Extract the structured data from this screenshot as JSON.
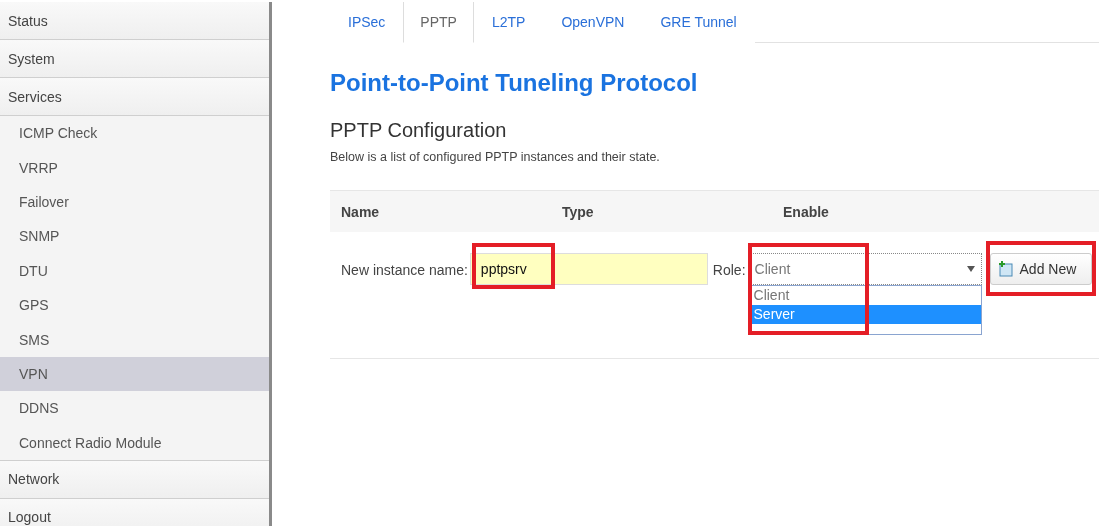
{
  "sidebar": {
    "items": [
      {
        "label": "Status",
        "selected": false
      },
      {
        "label": "System",
        "selected": false
      },
      {
        "label": "Services",
        "selected": false,
        "children": [
          {
            "label": "ICMP Check",
            "selected": false
          },
          {
            "label": "VRRP",
            "selected": false
          },
          {
            "label": "Failover",
            "selected": false
          },
          {
            "label": "SNMP",
            "selected": false
          },
          {
            "label": "DTU",
            "selected": false
          },
          {
            "label": "GPS",
            "selected": false
          },
          {
            "label": "SMS",
            "selected": false
          },
          {
            "label": "VPN",
            "selected": true
          },
          {
            "label": "DDNS",
            "selected": false
          },
          {
            "label": "Connect Radio Module",
            "selected": false
          }
        ]
      },
      {
        "label": "Network",
        "selected": false
      },
      {
        "label": "Logout",
        "selected": false
      }
    ]
  },
  "tabs": [
    {
      "label": "IPSec",
      "selected": false
    },
    {
      "label": "PPTP",
      "selected": true
    },
    {
      "label": "L2TP",
      "selected": false
    },
    {
      "label": "OpenVPN",
      "selected": false
    },
    {
      "label": "GRE Tunnel",
      "selected": false
    }
  ],
  "title": "Point-to-Point Tuneling Protocol",
  "section": {
    "title": "PPTP Configuration",
    "description": "Below is a list of configured PPTP instances and their state."
  },
  "table": {
    "columns": [
      "Name",
      "Type",
      "Enable"
    ]
  },
  "form": {
    "name_label": "New instance name:",
    "name_value": "pptpsrv",
    "name_highlighted": true,
    "role_label": "Role:",
    "role_value": "Client",
    "role_expanded": true,
    "role_highlighted": true,
    "role_options": [
      {
        "label": "Client",
        "selected": false
      },
      {
        "label": "Server",
        "selected": true
      }
    ],
    "button": "Add New",
    "button_highlighted": true
  }
}
